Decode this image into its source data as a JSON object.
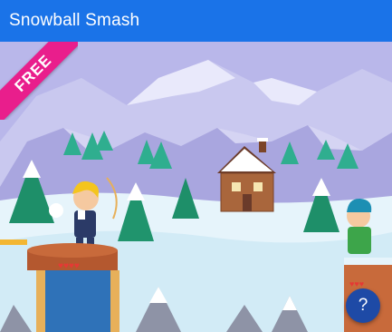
{
  "header": {
    "title": "Snowball Smash"
  },
  "badge": {
    "label": "FREE"
  },
  "help_button": {
    "label": "?"
  },
  "colors": {
    "header": "#1a73e8",
    "badge": "#e91e8c",
    "help": "#1e4aa6",
    "sky": "#b6b6e8"
  },
  "icons": [
    "help-icon"
  ]
}
